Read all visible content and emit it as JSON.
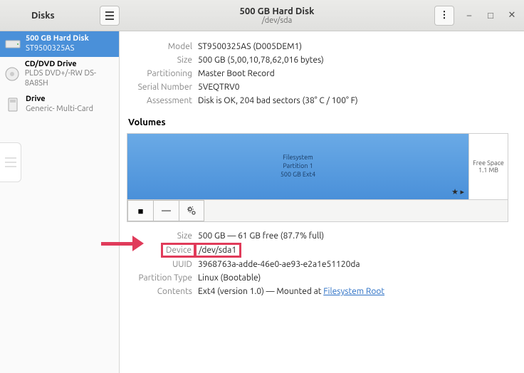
{
  "titlebar": {
    "app_title": "Disks",
    "disk_title": "500 GB Hard Disk",
    "disk_subtitle": "/dev/sda"
  },
  "sidebar": {
    "items": [
      {
        "name": "500 GB Hard Disk",
        "sub": "ST9500325AS"
      },
      {
        "name": "CD/DVD Drive",
        "sub": "PLDS DVD+/-RW DS-8A8SH"
      },
      {
        "name": "Drive",
        "sub": "Generic- Multi-Card"
      }
    ]
  },
  "drive": {
    "labels": {
      "model": "Model",
      "size": "Size",
      "partitioning": "Partitioning",
      "serial": "Serial Number",
      "assessment": "Assessment"
    },
    "model": "ST9500325AS (D005DEM1)",
    "size": "500 GB (5,00,10,78,62,016 bytes)",
    "partitioning": "Master Boot Record",
    "serial": "5VEQTRV0",
    "assessment": "Disk is OK, 204 bad sectors (38° C / 100° F)"
  },
  "volumes": {
    "header": "Volumes",
    "partition": {
      "line1": "Filesystem",
      "line2": "Partition 1",
      "line3": "500 GB Ext4",
      "star": "★ ▸"
    },
    "free": {
      "label": "Free Space",
      "size": "1.1 MB"
    }
  },
  "partition": {
    "labels": {
      "size": "Size",
      "device": "Device",
      "uuid": "UUID",
      "ptype": "Partition Type",
      "contents": "Contents"
    },
    "size": "500 GB — 61 GB free (87.7% full)",
    "device": "/dev/sda1",
    "uuid": "3968763a-adde-46e0-ae93-e2a1e51120da",
    "ptype": "Linux (Bootable)",
    "contents_prefix": "Ext4 (version 1.0) — Mounted at ",
    "contents_link": "Filesystem Root"
  }
}
